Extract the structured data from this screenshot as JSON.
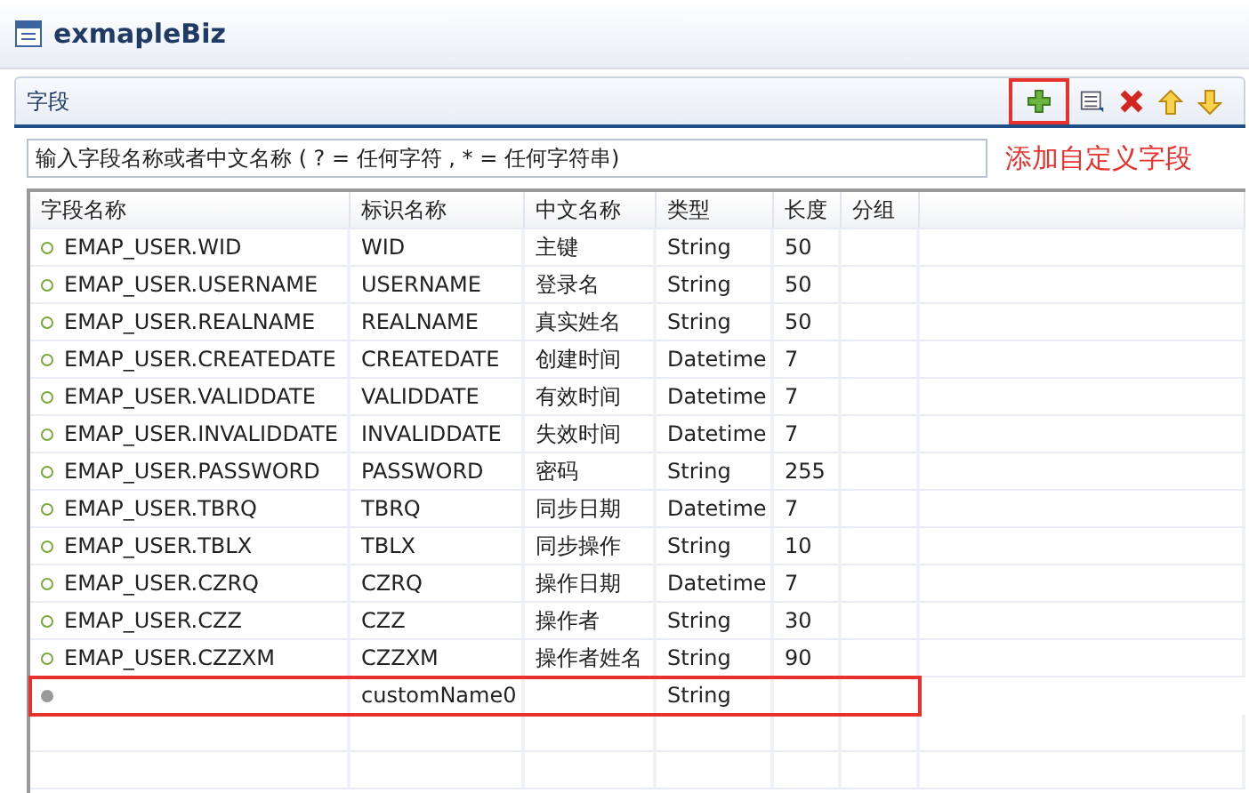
{
  "editor": {
    "title": "exmapleBiz"
  },
  "section": {
    "title": "字段",
    "toolbar": [
      {
        "kind": "add",
        "highlighted": true
      },
      {
        "kind": "list",
        "highlighted": false
      },
      {
        "kind": "delete",
        "highlighted": false
      },
      {
        "kind": "up",
        "highlighted": false
      },
      {
        "kind": "down",
        "highlighted": false
      }
    ]
  },
  "filter": {
    "placeholder": "输入字段名称或者中文名称 ( ? = 任何字符 , * = 任何字符串)"
  },
  "annotation": "添加自定义字段",
  "table": {
    "columns": [
      "字段名称",
      "标识名称",
      "中文名称",
      "类型",
      "长度",
      "分组"
    ],
    "rows": [
      {
        "kind": "field",
        "highlighted": false,
        "cells": [
          "EMAP_USER.WID",
          "WID",
          "主键",
          "String",
          "50",
          ""
        ]
      },
      {
        "kind": "field",
        "highlighted": false,
        "cells": [
          "EMAP_USER.USERNAME",
          "USERNAME",
          "登录名",
          "String",
          "50",
          ""
        ]
      },
      {
        "kind": "field",
        "highlighted": false,
        "cells": [
          "EMAP_USER.REALNAME",
          "REALNAME",
          "真实姓名",
          "String",
          "50",
          ""
        ]
      },
      {
        "kind": "field",
        "highlighted": false,
        "cells": [
          "EMAP_USER.CREATEDATE",
          "CREATEDATE",
          "创建时间",
          "Datetime",
          "7",
          ""
        ]
      },
      {
        "kind": "field",
        "highlighted": false,
        "cells": [
          "EMAP_USER.VALIDDATE",
          "VALIDDATE",
          "有效时间",
          "Datetime",
          "7",
          ""
        ]
      },
      {
        "kind": "field",
        "highlighted": false,
        "cells": [
          "EMAP_USER.INVALIDDATE",
          "INVALIDDATE",
          "失效时间",
          "Datetime",
          "7",
          ""
        ]
      },
      {
        "kind": "field",
        "highlighted": false,
        "cells": [
          "EMAP_USER.PASSWORD",
          "PASSWORD",
          "密码",
          "String",
          "255",
          ""
        ]
      },
      {
        "kind": "field",
        "highlighted": false,
        "cells": [
          "EMAP_USER.TBRQ",
          "TBRQ",
          "同步日期",
          "Datetime",
          "7",
          ""
        ]
      },
      {
        "kind": "field",
        "highlighted": false,
        "cells": [
          "EMAP_USER.TBLX",
          "TBLX",
          "同步操作",
          "String",
          "10",
          ""
        ]
      },
      {
        "kind": "field",
        "highlighted": false,
        "cells": [
          "EMAP_USER.CZRQ",
          "CZRQ",
          "操作日期",
          "Datetime",
          "7",
          ""
        ]
      },
      {
        "kind": "field",
        "highlighted": false,
        "cells": [
          "EMAP_USER.CZZ",
          "CZZ",
          "操作者",
          "String",
          "30",
          ""
        ]
      },
      {
        "kind": "field",
        "highlighted": false,
        "cells": [
          "EMAP_USER.CZZXM",
          "CZZXM",
          "操作者姓名",
          "String",
          "90",
          ""
        ]
      },
      {
        "kind": "custom",
        "highlighted": true,
        "cells": [
          "",
          "customName0",
          "",
          "String",
          "",
          ""
        ]
      }
    ]
  }
}
